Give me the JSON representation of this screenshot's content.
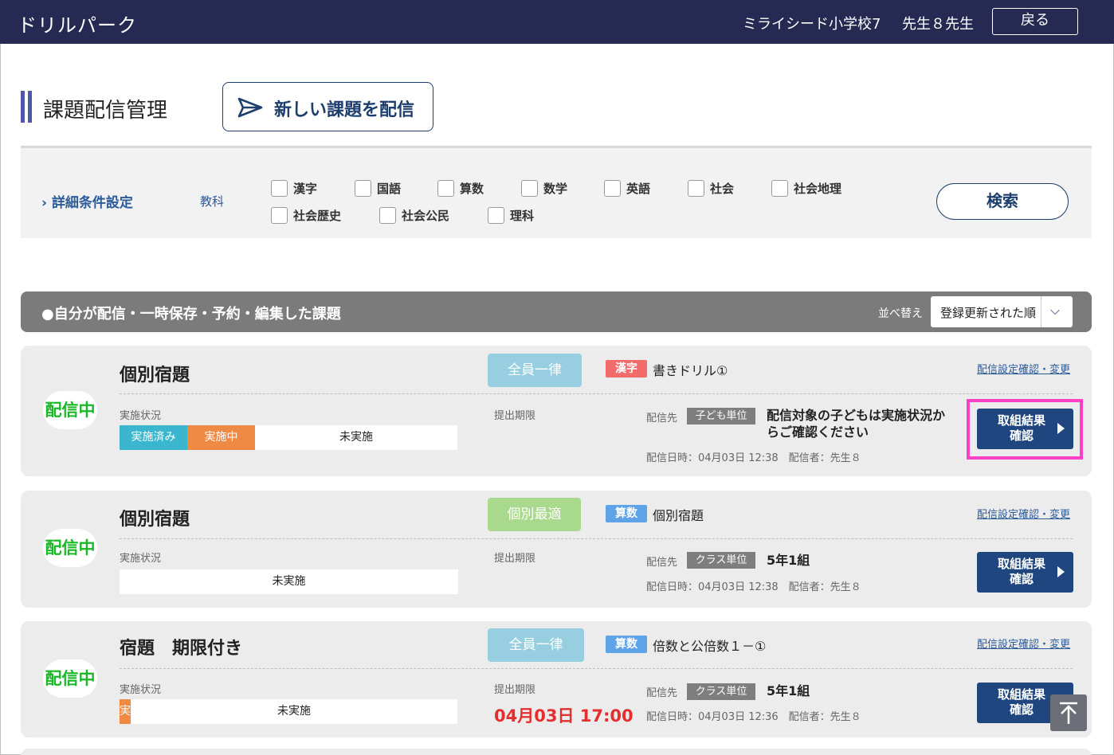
{
  "header": {
    "brand": "ドリルパーク",
    "school": "ミライシード小学校7",
    "teacher": "先生８先生",
    "back_label": "戻る"
  },
  "page": {
    "title": "課題配信管理",
    "new_button_label": "新しい課題を配信"
  },
  "filter": {
    "detail_label": "詳細条件設定",
    "subject_label": "教科",
    "subjects": [
      "漢字",
      "国語",
      "算数",
      "数学",
      "英語",
      "社会",
      "社会地理",
      "社会歴史",
      "社会公民",
      "理科"
    ],
    "search_label": "検索"
  },
  "list": {
    "title": "●自分が配信・一時保存・予約・編集した課題",
    "sort_label": "並べ替え",
    "sort_value": "登録更新された順"
  },
  "labels": {
    "progress": "実施状況",
    "deadline": "提出期限",
    "target": "配信先",
    "config_link": "配信設定確認・変更",
    "result_line1": "取組結果",
    "result_line2": "確認"
  },
  "cards": [
    {
      "status": "配信中",
      "name": "個別宿題",
      "type": "全員一律",
      "subject": "漢字",
      "subject_color": "#f26b6b",
      "drill": "書きドリル①",
      "progress": {
        "done_label": "実施済み",
        "in_progress_label": "実施中",
        "not_done_label": "未実施"
      },
      "deadline": "",
      "unit": "子ども単位",
      "target_text": "配信対象の子どもは実施状況からご確認ください",
      "meta": "配信日時：04月03日 12:38　配信者：先生８"
    },
    {
      "status": "配信中",
      "name": "個別宿題",
      "type": "個別最適",
      "subject": "算数",
      "subject_color": "#5ea3e8",
      "drill": "個別宿題",
      "progress": {
        "not_done_label": "未実施"
      },
      "deadline": "",
      "unit": "クラス単位",
      "target_text": "5年1組",
      "meta": "配信日時：04月03日 12:38　配信者：先生８"
    },
    {
      "status": "配信中",
      "name": "宿題　期限付き",
      "type": "全員一律",
      "subject": "算数",
      "subject_color": "#5ea3e8",
      "drill": "倍数と公倍数１－①",
      "progress": {
        "in_progress_label": "実",
        "not_done_label": "未実施"
      },
      "deadline": "04月03日 17:00",
      "unit": "クラス単位",
      "target_text": "5年1組",
      "meta": "配信日時：04月03日 12:36　配信者：先生８"
    }
  ],
  "colors": {
    "header_bg": "#262a52",
    "accent_navy": "#20467f",
    "status_green": "#19b826",
    "type_all": "#97cfe0",
    "type_individual": "#a9d98d",
    "done": "#3bb6cf",
    "in_progress": "#ef8a44",
    "deadline_red": "#e52e2e",
    "highlight": "#ff3fc8"
  },
  "icons": {
    "new_button": "paper-plane-icon",
    "detail": "chevron-right-icon",
    "sort": "chevron-down-icon",
    "result": "triangle-right-icon",
    "to_top": "arrow-up-icon"
  }
}
